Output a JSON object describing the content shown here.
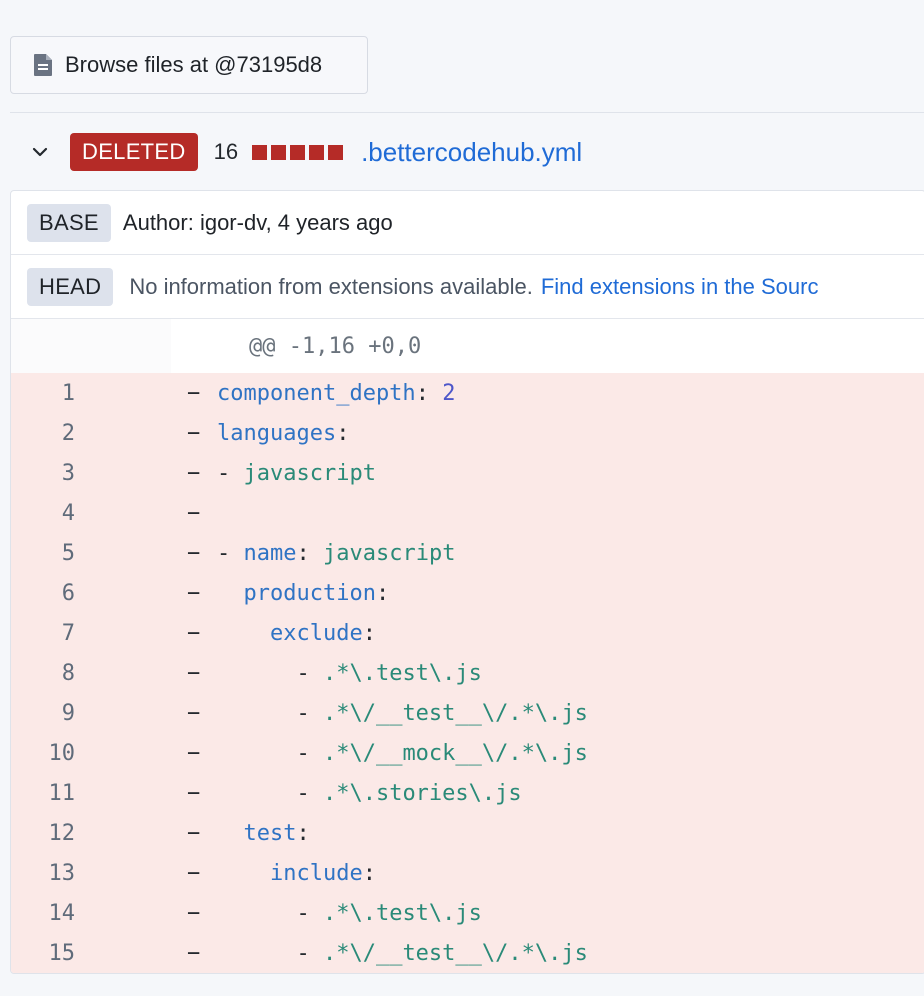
{
  "browse_button": {
    "label": "Browse files at @73195d8",
    "icon": "file-icon"
  },
  "file_header": {
    "status": "DELETED",
    "count": "16",
    "stat_blocks": 5,
    "stat_color": "#b52b27",
    "file_name": ".bettercodehub.yml"
  },
  "base_row": {
    "badge": "BASE",
    "text": "Author: igor-dv, 4 years ago"
  },
  "head_row": {
    "badge": "HEAD",
    "text": "No information from extensions available.",
    "link": "Find extensions in the Sourc"
  },
  "hunk_header": "@@ -1,16 +0,0",
  "diff_lines": [
    {
      "num": "1",
      "tokens": [
        {
          "t": "component_depth",
          "c": "k"
        },
        {
          "t": ": ",
          "c": "p"
        },
        {
          "t": "2",
          "c": "n"
        }
      ]
    },
    {
      "num": "2",
      "tokens": [
        {
          "t": "languages",
          "c": "k"
        },
        {
          "t": ":",
          "c": "p"
        }
      ]
    },
    {
      "num": "3",
      "tokens": [
        {
          "t": "- ",
          "c": "p"
        },
        {
          "t": "javascript",
          "c": "s"
        }
      ]
    },
    {
      "num": "4",
      "tokens": []
    },
    {
      "num": "5",
      "tokens": [
        {
          "t": "- ",
          "c": "p"
        },
        {
          "t": "name",
          "c": "k"
        },
        {
          "t": ": ",
          "c": "p"
        },
        {
          "t": "javascript",
          "c": "s"
        }
      ]
    },
    {
      "num": "6",
      "tokens": [
        {
          "t": "  ",
          "c": "p"
        },
        {
          "t": "production",
          "c": "k"
        },
        {
          "t": ":",
          "c": "p"
        }
      ]
    },
    {
      "num": "7",
      "tokens": [
        {
          "t": "    ",
          "c": "p"
        },
        {
          "t": "exclude",
          "c": "k"
        },
        {
          "t": ":",
          "c": "p"
        }
      ]
    },
    {
      "num": "8",
      "tokens": [
        {
          "t": "      - ",
          "c": "p"
        },
        {
          "t": ".*\\.test\\.js",
          "c": "s"
        }
      ]
    },
    {
      "num": "9",
      "tokens": [
        {
          "t": "      - ",
          "c": "p"
        },
        {
          "t": ".*\\/__test__\\/.*\\.js",
          "c": "s"
        }
      ]
    },
    {
      "num": "10",
      "tokens": [
        {
          "t": "      - ",
          "c": "p"
        },
        {
          "t": ".*\\/__mock__\\/.*\\.js",
          "c": "s"
        }
      ]
    },
    {
      "num": "11",
      "tokens": [
        {
          "t": "      - ",
          "c": "p"
        },
        {
          "t": ".*\\.stories\\.js",
          "c": "s"
        }
      ]
    },
    {
      "num": "12",
      "tokens": [
        {
          "t": "  ",
          "c": "p"
        },
        {
          "t": "test",
          "c": "k"
        },
        {
          "t": ":",
          "c": "p"
        }
      ]
    },
    {
      "num": "13",
      "tokens": [
        {
          "t": "    ",
          "c": "p"
        },
        {
          "t": "include",
          "c": "k"
        },
        {
          "t": ":",
          "c": "p"
        }
      ]
    },
    {
      "num": "14",
      "tokens": [
        {
          "t": "      - ",
          "c": "p"
        },
        {
          "t": ".*\\.test\\.js",
          "c": "s"
        }
      ]
    },
    {
      "num": "15",
      "tokens": [
        {
          "t": "      - ",
          "c": "p"
        },
        {
          "t": ".*\\/__test__\\/.*\\.js",
          "c": "s"
        }
      ]
    }
  ],
  "minus_symbol": "−"
}
